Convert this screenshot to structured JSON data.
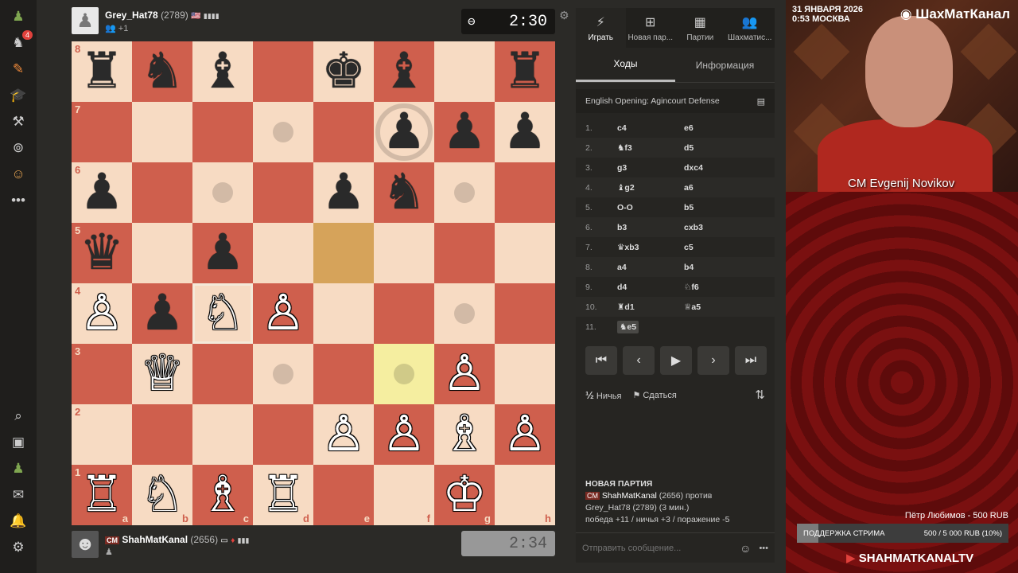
{
  "rail": {
    "icons": [
      "pawn-icon",
      "puzzle-icon",
      "learn-icon",
      "education-icon",
      "tools-icon",
      "binoculars-icon",
      "community-icon",
      "more-icon"
    ],
    "badge": "4",
    "bottom_icons": [
      "search-icon",
      "user-avatar",
      "friends-icon",
      "mail-icon",
      "bell-icon",
      "settings-icon"
    ]
  },
  "top_player": {
    "name": "Grey_Hat78",
    "rating": "(2789)",
    "sub": "+1",
    "clock": "2:30"
  },
  "bottom_player": {
    "title": "CM",
    "name": "ShahMatKanal",
    "rating": "(2656)",
    "clock": "2:34"
  },
  "board": {
    "files": [
      "a",
      "b",
      "c",
      "d",
      "e",
      "f",
      "g",
      "h"
    ],
    "ranks": [
      "8",
      "7",
      "6",
      "5",
      "4",
      "3",
      "2",
      "1"
    ],
    "pieces": {
      "a8": "♜",
      "b8": "♞",
      "c8": "♝",
      "e8": "♚",
      "f8": "♝",
      "h8": "♜",
      "f7": "♟",
      "g7": "♟",
      "h7": "♟",
      "a6": "♟",
      "e6": "♟",
      "f6": "♞",
      "a5": "♛",
      "c5": "♟",
      "a4": "♙",
      "b4": "♟",
      "c4": "♘",
      "d4": "♙",
      "b3": "♕",
      "g3": "♙",
      "e2": "♙",
      "f2": "♙",
      "g2": "♗",
      "h2": "♙",
      "a1": "♖",
      "b1": "♘",
      "c1": "♗",
      "d1": "♖",
      "g1": "♔"
    },
    "white_squares": [
      "a4",
      "c4",
      "d4",
      "b3",
      "g3",
      "e2",
      "f2",
      "g2",
      "h2",
      "a1",
      "b1",
      "c1",
      "d1",
      "g1"
    ],
    "dots": [
      "d7",
      "c6",
      "g6",
      "g4",
      "d3",
      "f3"
    ],
    "ring": "f7",
    "last_move": "e5",
    "selected_target": "f3",
    "selected_piece": "c4"
  },
  "panel": {
    "tabs": [
      {
        "icon": "⚡",
        "label": "Играть"
      },
      {
        "icon": "⊞",
        "label": "Новая пар..."
      },
      {
        "icon": "▦",
        "label": "Партии"
      },
      {
        "icon": "👥",
        "label": "Шахматис..."
      }
    ],
    "subtabs": [
      "Ходы",
      "Информация"
    ],
    "opening": "English Opening: Agincourt Defense",
    "moves": [
      {
        "n": "1.",
        "w": "c4",
        "b": "e6"
      },
      {
        "n": "2.",
        "w": "♞f3",
        "b": "d5"
      },
      {
        "n": "3.",
        "w": "g3",
        "b": "dxc4"
      },
      {
        "n": "4.",
        "w": "♝g2",
        "b": "a6"
      },
      {
        "n": "5.",
        "w": "O-O",
        "b": "b5"
      },
      {
        "n": "6.",
        "w": "b3",
        "b": "cxb3"
      },
      {
        "n": "7.",
        "w": "♛xb3",
        "b": "c5"
      },
      {
        "n": "8.",
        "w": "a4",
        "b": "b4"
      },
      {
        "n": "9.",
        "w": "d4",
        "b": "♘f6"
      },
      {
        "n": "10.",
        "w": "♜d1",
        "b": "♕a5"
      },
      {
        "n": "11.",
        "w": "♞e5",
        "b": ""
      }
    ],
    "nav": [
      "⏮",
      "‹",
      "▶",
      "›",
      "⏭"
    ],
    "draw": "Ничья",
    "draw_prefix": "½",
    "resign": "Сдаться",
    "game": {
      "heading": "НОВАЯ ПАРТИЯ",
      "line1_title": "CM",
      "line1": "ShahMatKanal",
      "line1_rating": "(2656) против",
      "line2": "Grey_Hat78 (2789) (3 мин.)",
      "line3": "победа +11 / ничья +3 / поражение -5"
    },
    "chat_placeholder": "Отправить сообщение..."
  },
  "stream": {
    "date": "31 ЯНВАРЯ 2026",
    "time": "0:53 МОСКВА",
    "channel": "ШахМатКанал",
    "cam_name": "CM Evgenij Novikov",
    "donor": "Пётр Любимов - 500 RUB",
    "support_label": "ПОДДЕРЖКА СТРИМА",
    "support_value": "500 / 5 000 RUB (10%)",
    "support_fraction": 0.1,
    "youtube": "SHAHMATKANALTV"
  },
  "colors": {
    "light": "#f7dbc3",
    "dark": "#cf5f4d",
    "last": "#d6a35a",
    "selected": "#f5eea0"
  }
}
